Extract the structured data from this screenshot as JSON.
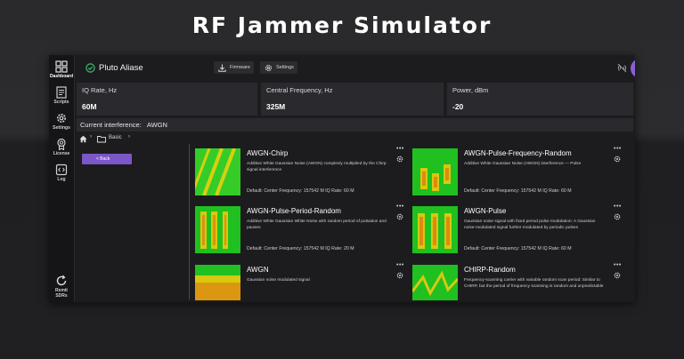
{
  "hero": {
    "title": "RF Jammer Simulator"
  },
  "sidebar": {
    "items": [
      {
        "label": "Dashboard",
        "icon": "grid-icon"
      },
      {
        "label": "Scripts",
        "icon": "script-icon"
      },
      {
        "label": "Settings",
        "icon": "gear-icon"
      },
      {
        "label": "License",
        "icon": "badge-icon"
      },
      {
        "label": "Log",
        "icon": "code-icon"
      }
    ],
    "bottom_label_1": "Remit",
    "bottom_label_2": "SDRs"
  },
  "topbar": {
    "device_name": "Pluto Aliase",
    "firmware_label": "Firmware",
    "settings_label": "Settings"
  },
  "metrics": [
    {
      "label": "IQ Rate, Hz",
      "value": "60M"
    },
    {
      "label": "Central Frequency, Hz",
      "value": "325M"
    },
    {
      "label": "Power, dBm",
      "value": "-20"
    }
  ],
  "interference": {
    "label": "Current interference:",
    "value": "AWGN"
  },
  "breadcrumb": {
    "folder": "Basic"
  },
  "back_label": "< Back",
  "cards": [
    {
      "title": "AWGN-Chirp",
      "description": "Additive White Gaussian Noise (AWGN) complexly multiplied by the Chirp signal interference",
      "meta": "Default: Center Frequency: 157542 M   IQ Rate: 60 M",
      "thumb": "chirp"
    },
    {
      "title": "AWGN-Pulse-Frequency-Random",
      "description": "Additive White Gaussian Noise (AWGN) interference — Pulse",
      "meta": "Default: Center Frequency: 157542 M   IQ Rate: 60 M",
      "thumb": "pulse-random"
    },
    {
      "title": "AWGN-Pulse-Period-Random",
      "description": "Additive White Gaussian White Noise with random period of pulsation and pauses",
      "meta": "Default: Center Frequency: 157542 M   IQ Rate: 20 M",
      "thumb": "pulse-period"
    },
    {
      "title": "AWGN-Pulse",
      "description": "Gaussian noise signal with fixed period pulse modulation: A Gaussian noise-modulated signal further modulated by periodic pulses",
      "meta": "Default: Center Frequency: 157542 M   IQ Rate: 60 M",
      "thumb": "pulse"
    },
    {
      "title": "AWGN",
      "description": "Gaussian noise modulated signal",
      "meta": "",
      "thumb": "noise"
    },
    {
      "title": "CHIRP-Random",
      "description": "Frequency-scanning carrier with variable random scan period: Similar to CHIRP, but the period of frequency scanning is random and unpredictable",
      "meta": "",
      "thumb": "chirp-random"
    }
  ],
  "colors": {
    "accent": "#8b5ed6",
    "back_button": "#7b57c7",
    "check": "#3fbf6f",
    "spectrum_green": "#22dd22",
    "spectrum_yellow": "#e8d400"
  }
}
